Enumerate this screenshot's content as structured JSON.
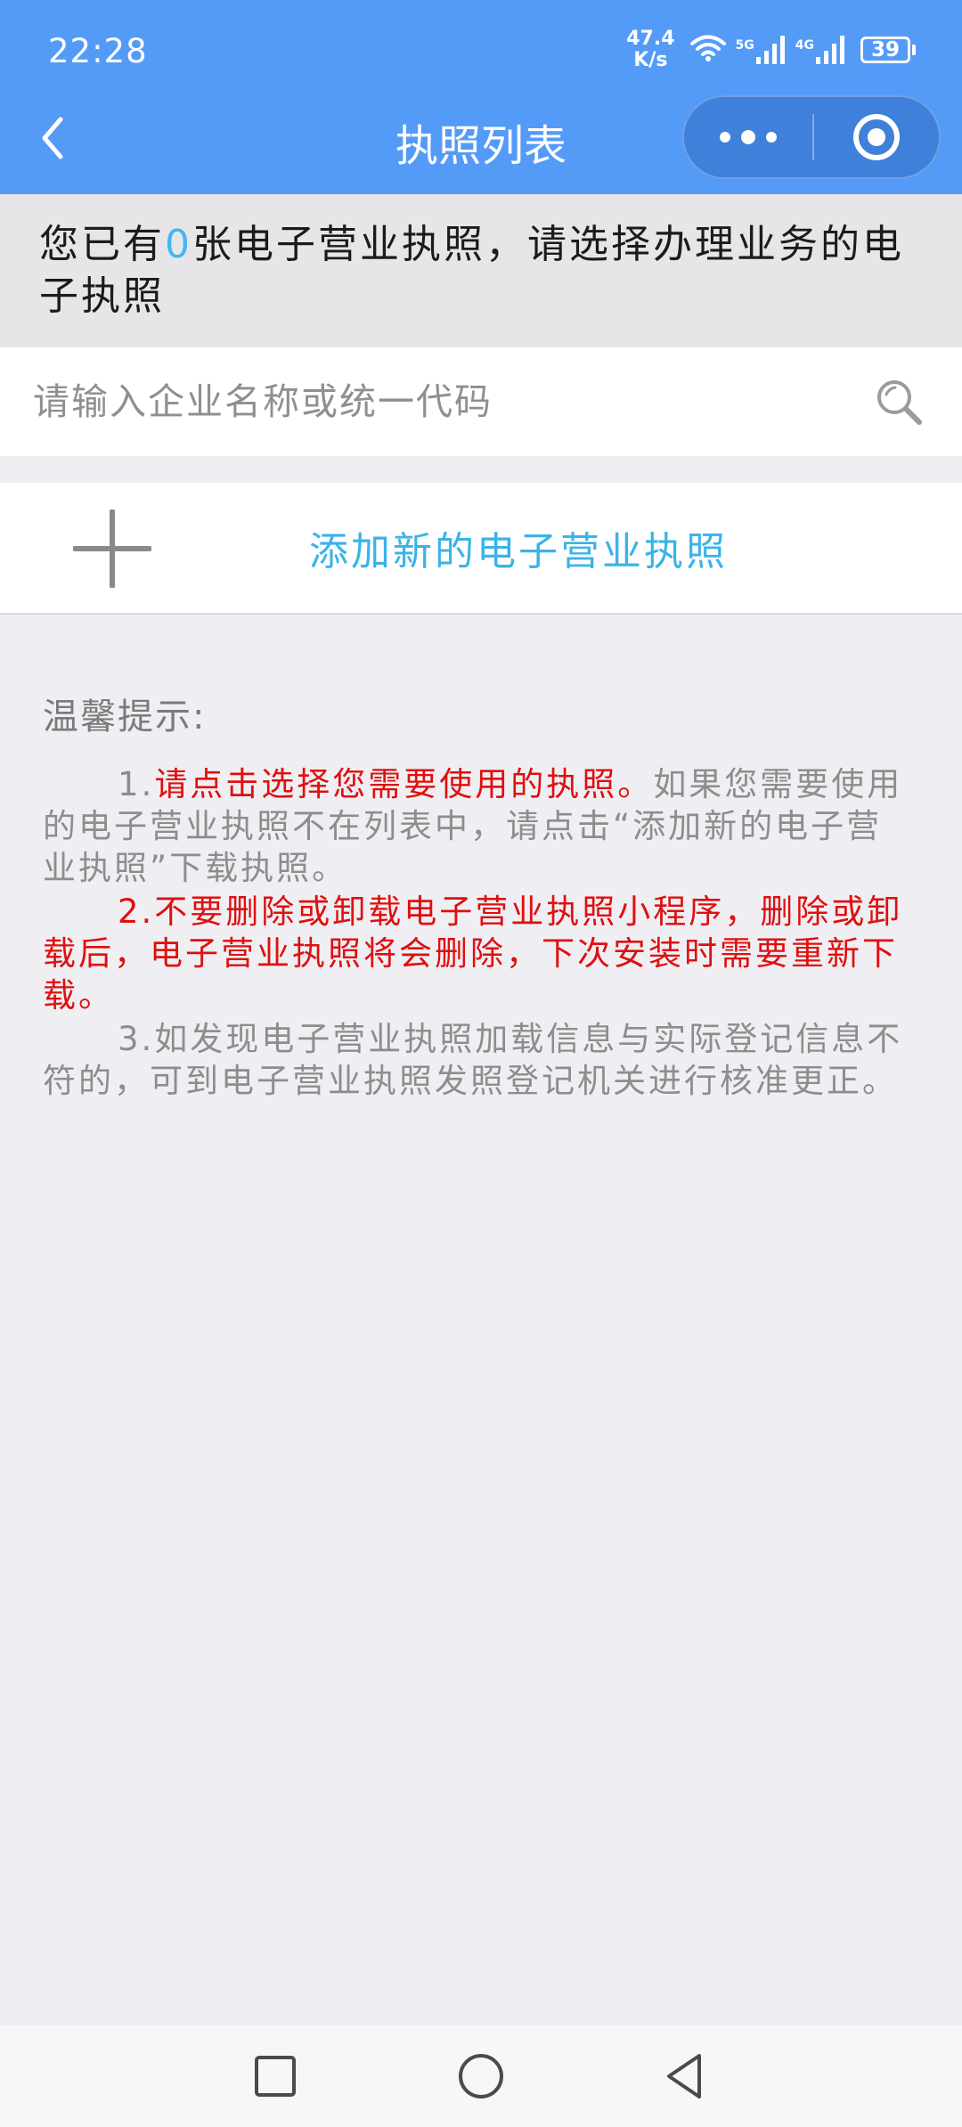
{
  "status_bar": {
    "time": "22:28",
    "net_speed_value": "47.4",
    "net_speed_unit": "K/s",
    "signal1_tag": "5G",
    "signal2_tag": "4G",
    "battery": "39",
    "icons": [
      "wifi-icon",
      "signal-5g-icon",
      "signal-4g-icon",
      "battery-icon"
    ]
  },
  "nav": {
    "title": "执照列表",
    "back_icon": "chevron-left-icon",
    "more_icon": "more-dots-icon",
    "close_icon": "target-circle-icon"
  },
  "notice": {
    "prefix": "您已有",
    "count": "0",
    "suffix": "张电子营业执照，请选择办理业务的电子执照",
    "count_color": "#40b8f2"
  },
  "search": {
    "placeholder": "请输入企业名称或统一代码",
    "value": "",
    "icon": "search-icon"
  },
  "add_license": {
    "label": "添加新的电子营业执照",
    "icon": "plus-icon",
    "label_color": "#3ab3e8"
  },
  "tips": {
    "title": "温馨提示:",
    "tip1_num": "1.",
    "tip1_red": "请点击选择您需要使用的执照。",
    "tip1_rest": "如果您需要使用的电子营业执照不在列表中，请点击“添加新的电子营业执照”下载执照。",
    "tip2": "2.不要删除或卸载电子营业执照小程序，删除或卸载后，电子营业执照将会删除，下次安装时需要重新下载。",
    "tip3": "3.如发现电子营业执照加载信息与实际登记信息不符的，可到电子营业执照发照登记机关进行核准更正。",
    "red_color": "#e00f0f"
  },
  "system_nav": {
    "icons": [
      "recent-apps-icon",
      "home-icon",
      "back-triangle-icon"
    ]
  },
  "colors": {
    "header": "#549bf8",
    "background": "#efeff3"
  }
}
